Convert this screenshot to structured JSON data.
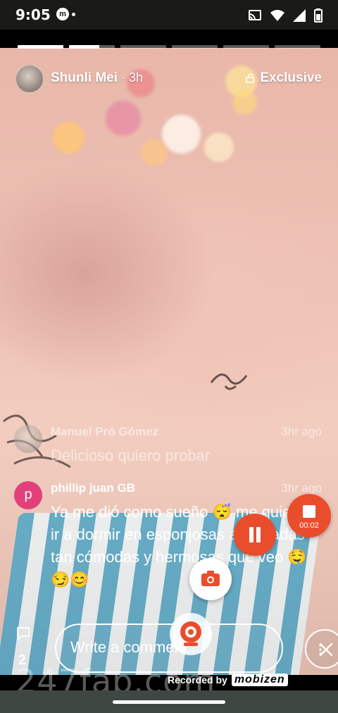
{
  "status_bar": {
    "time": "9:05",
    "icons": [
      "m-app-icon",
      "notification-dot",
      "cast-icon",
      "wifi-icon",
      "signal-icon",
      "battery-icon"
    ]
  },
  "story": {
    "progress": [
      1.0,
      0.66,
      0.0,
      0.0,
      0.0,
      0.0
    ],
    "author": "Shunli Mei",
    "age": " · 3h",
    "exclusive_label": "Exclusive"
  },
  "comments": [
    {
      "name": "Manuel Pró Gómez",
      "time": "3hr ago",
      "text": "Delicioso quiero probar",
      "avatar_color": "#c8c0b8"
    },
    {
      "name": "phillip juan GB",
      "time": "3hr ago",
      "text": "Ya me dió como sueño 😴 me quiero ir a dormir en esponjosas almohadas tan cómodas y hermosas que veo 🤤 😏😊",
      "avatar_letter": "p",
      "avatar_color": "#e2407a"
    }
  ],
  "composer": {
    "comment_count": "2",
    "placeholder": "Write a comment ..."
  },
  "recorder": {
    "timer": "00:02",
    "recorded_by": "Recorded by",
    "brand": "mobizen",
    "accent": "#ea4d2c"
  },
  "watermark": "247fap.com"
}
